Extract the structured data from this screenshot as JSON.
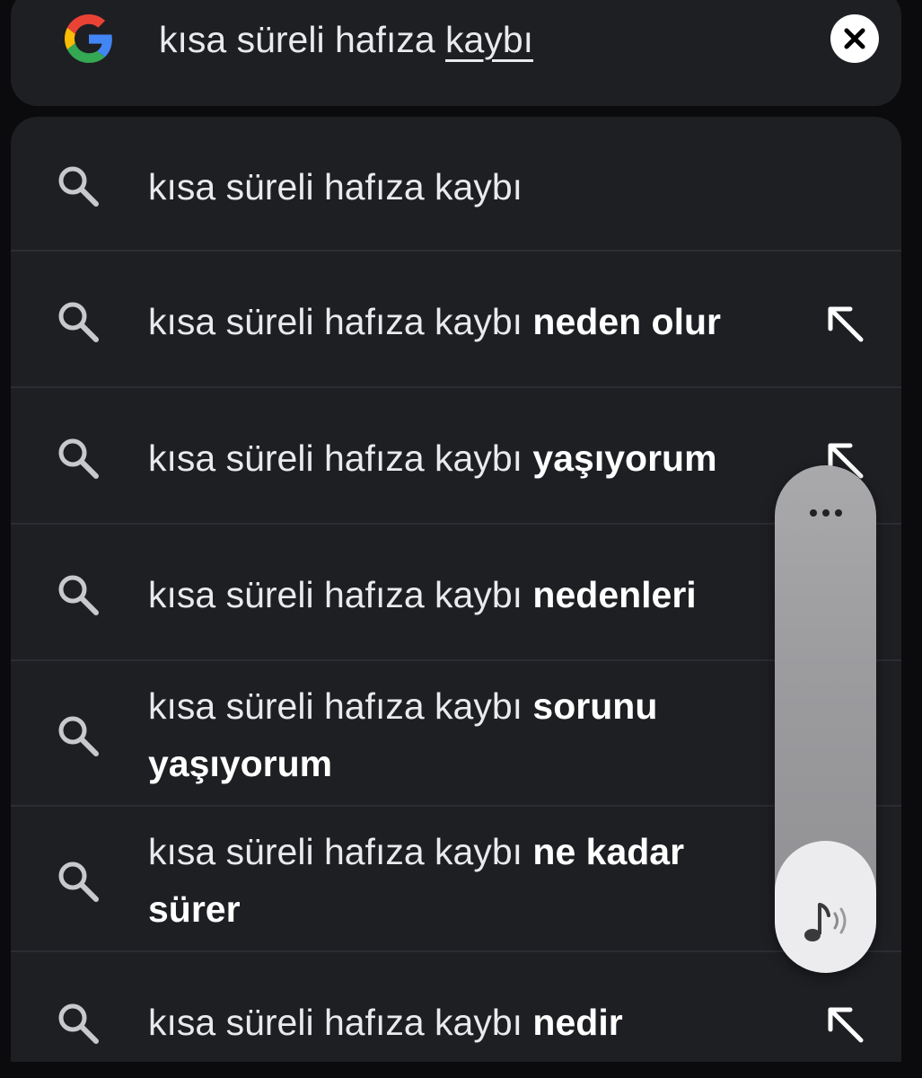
{
  "search": {
    "query_prefix": "kısa süreli hafıza ",
    "query_underlined": "kaybı",
    "clear_icon": "close-icon",
    "logo_icon": "google-g-icon"
  },
  "suggestions": [
    {
      "base": "kısa süreli hafıza kaybı",
      "completion": "",
      "fill_arrow": false
    },
    {
      "base": "kısa süreli hafıza kaybı ",
      "completion": "neden olur",
      "fill_arrow": true
    },
    {
      "base": "kısa süreli hafıza kaybı ",
      "completion": "yaşıyorum",
      "fill_arrow": true
    },
    {
      "base": "kısa süreli hafıza kaybı ",
      "completion": "nedenleri",
      "fill_arrow": false
    },
    {
      "base": "kısa süreli hafıza kaybı ",
      "completion": "sorunu yaşıyorum",
      "fill_arrow": false
    },
    {
      "base": "kısa süreli hafıza kaybı ",
      "completion": "ne kadar sürer",
      "fill_arrow": false
    },
    {
      "base": "kısa süreli hafıza kaybı ",
      "completion": "nedir",
      "fill_arrow": true
    }
  ],
  "volume_overlay": {
    "level_percent": 26,
    "more_icon": "more-horizontal-icon",
    "media_icon": "music-note-volume-icon"
  },
  "colors": {
    "background": "#0b0b0d",
    "surface": "#1e1f23",
    "divider": "#2c2d32",
    "text": "#e8eaed",
    "volume_track": "#9c9c9f",
    "volume_fill": "#ececee"
  }
}
